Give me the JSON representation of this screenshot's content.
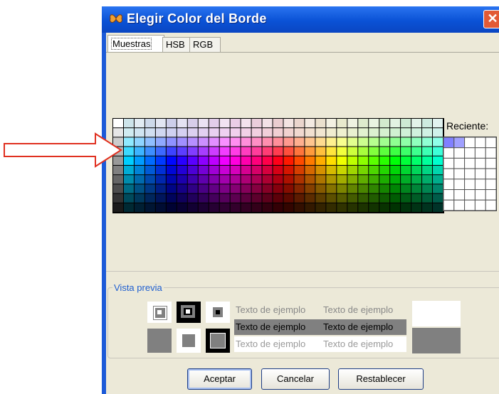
{
  "window": {
    "title": "Elegir Color del Borde",
    "close": "✕"
  },
  "tabs": [
    {
      "label": "Muestras"
    },
    {
      "label": "HSB"
    },
    {
      "label": "RGB"
    }
  ],
  "swatches": {
    "recent_label": "Reciente:"
  },
  "preview": {
    "label": "Vista previa",
    "sample_text": "Texto de ejemplo"
  },
  "buttons": {
    "ok": "Aceptar",
    "cancel": "Cancelar",
    "reset": "Restablecer"
  },
  "colors": {
    "title_bar": "#0a52d6",
    "arrow": "#e03020",
    "accent": "#1f5fd0"
  }
}
